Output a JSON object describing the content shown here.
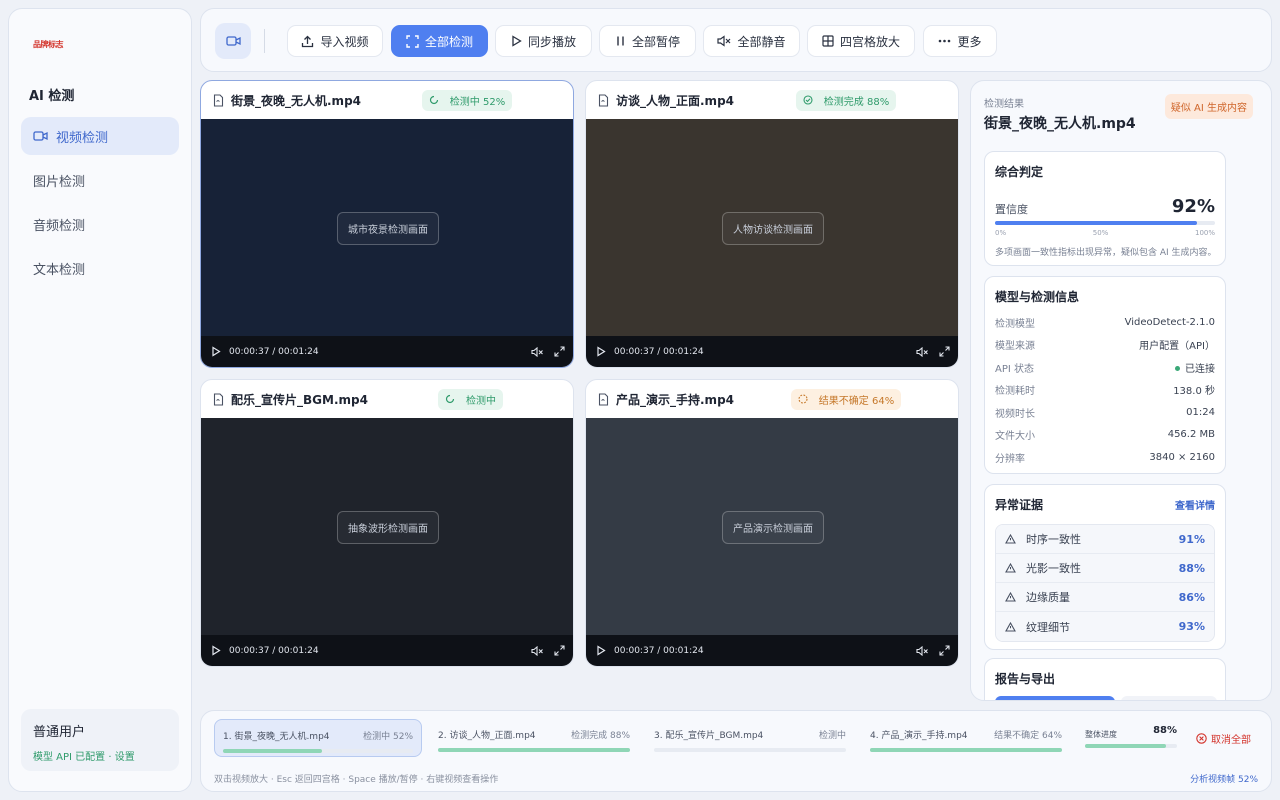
{
  "sidebar": {
    "logo": "BRAND",
    "app_title": "AI 检测",
    "items": [
      {
        "label": "视频检测",
        "icon": "video-icon",
        "active": true
      },
      {
        "label": "图片检测"
      },
      {
        "label": "音频检测"
      },
      {
        "label": "文本检测"
      }
    ],
    "user": {
      "name": "普通用户",
      "status": "模型 API 已配置 · 设置"
    }
  },
  "toolbar": {
    "import_label": "导入视频",
    "detect_all_label": "全部检测",
    "sync_play_label": "同步播放",
    "pause_all_label": "全部暂停",
    "mute_all_label": "全部静音",
    "grid_zoom_label": "四宫格放大",
    "more_label": "更多"
  },
  "videos": [
    {
      "filename": "街景_夜晚_无人机.mp4",
      "status": "检测中 52%",
      "status_color": "#2f9b6b",
      "screen_label": "城市夜景检测画面",
      "screen_color": "#172237",
      "time": "00:00:37 / 00:01:24"
    },
    {
      "filename": "访谈_人物_正面.mp4",
      "status": "检测完成 88%",
      "status_color": "#2f9b6b",
      "screen_label": "人物访谈检测画面",
      "screen_color": "#3a352f",
      "time": "00:00:37 / 00:01:24"
    },
    {
      "filename": "配乐_宣传片_BGM.mp4",
      "status": "检测中",
      "status_color": "#2f9b6b",
      "screen_label": "抽象波形检测画面",
      "screen_color": "#1f232b",
      "time": "00:00:37 / 00:01:24"
    },
    {
      "filename": "产品_演示_手持.mp4",
      "status": "结果不确定 64%",
      "status_color": "#c5782a",
      "screen_label": "产品演示检测画面",
      "screen_color": "#343b45",
      "time": "00:00:37 / 00:01:24"
    }
  ],
  "result": {
    "label": "检测结果",
    "filename": "街景_夜晚_无人机.mp4",
    "flag": "疑似 AI 生成内容",
    "verdict": {
      "title": "综合判定",
      "confidence_label": "置信度",
      "confidence_value": "92%",
      "confidence": 0.92,
      "ticks": [
        "0%",
        "50%",
        "100%"
      ],
      "note": "多项画面一致性指标出现异常，疑似包含 AI 生成内容。"
    },
    "model_info": {
      "title": "模型与检测信息",
      "rows": [
        {
          "k": "检测模型",
          "v": "VideoDetect-2.1.0"
        },
        {
          "k": "模型来源",
          "v": "用户配置（API）"
        },
        {
          "k": "API 状态",
          "v": "已连接"
        },
        {
          "k": "检测耗时",
          "v": "138.0 秒"
        },
        {
          "k": "视频时长",
          "v": "01:24"
        },
        {
          "k": "文件大小",
          "v": "456.2 MB"
        },
        {
          "k": "分辨率",
          "v": "3840 × 2160"
        }
      ]
    },
    "evidence": {
      "title": "异常证据",
      "link": "查看详情",
      "rows": [
        {
          "k": "时序一致性",
          "v": "91%"
        },
        {
          "k": "光影一致性",
          "v": "88%"
        },
        {
          "k": "边缘质量",
          "v": "86%"
        },
        {
          "k": "纹理细节",
          "v": "93%"
        }
      ]
    },
    "report": {
      "title": "报告与导出"
    }
  },
  "queue": {
    "items": [
      {
        "name": "1. 街景_夜晚_无人机.mp4",
        "status": "检测中 52%",
        "progress": 0.52,
        "active": true
      },
      {
        "name": "2. 访谈_人物_正面.mp4",
        "status": "检测完成 88%",
        "progress": 1.0
      },
      {
        "name": "3. 配乐_宣传片_BGM.mp4",
        "status": "检测中",
        "progress": 0.0
      },
      {
        "name": "4. 产品_演示_手持.mp4",
        "status": "结果不确定 64%",
        "progress": 1.0
      }
    ],
    "overall_label": "整体进度",
    "overall_value": "88%",
    "overall": 0.88,
    "cancel_label": "取消全部",
    "hint": "双击视频放大 · Esc 返回四宫格 · Space 播放/暂停 · 右键视频查看操作",
    "status": "分析视频帧 52%"
  },
  "colors": {
    "accent": "#4f7ff0",
    "success": "#2f9b6b",
    "warning": "#c5782a",
    "danger": "#d3332b"
  }
}
